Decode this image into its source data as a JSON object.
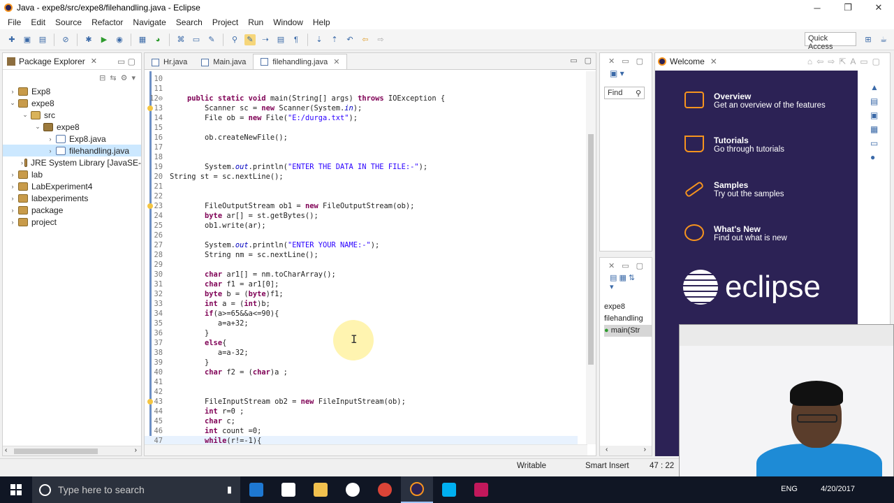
{
  "window": {
    "title": "Java - expe8/src/expe8/filehandling.java - Eclipse",
    "minimize": "─",
    "restore": "❐",
    "close": "✕"
  },
  "menu": [
    "File",
    "Edit",
    "Source",
    "Refactor",
    "Navigate",
    "Search",
    "Project",
    "Run",
    "Window",
    "Help"
  ],
  "toolbar": {
    "quick_access": "Quick Access"
  },
  "package_explorer": {
    "title": "Package Explorer",
    "items": [
      {
        "label": "Exp8",
        "level": 0,
        "arrow": "›",
        "icon": "project-icon"
      },
      {
        "label": "expe8",
        "level": 0,
        "arrow": "⌄",
        "icon": "project-icon"
      },
      {
        "label": "src",
        "level": 1,
        "arrow": "⌄",
        "icon": "source-folder-icon"
      },
      {
        "label": "expe8",
        "level": 2,
        "arrow": "⌄",
        "icon": "package-icon"
      },
      {
        "label": "Exp8.java",
        "level": 3,
        "arrow": "›",
        "icon": "java-file-icon"
      },
      {
        "label": "filehandling.java",
        "level": 3,
        "arrow": "›",
        "icon": "java-file-icon",
        "selected": true
      },
      {
        "label": "JRE System Library [JavaSE-",
        "level": 1,
        "arrow": "›",
        "icon": "library-icon"
      },
      {
        "label": "lab",
        "level": 0,
        "arrow": "›",
        "icon": "project-icon"
      },
      {
        "label": "LabExperiment4",
        "level": 0,
        "arrow": "›",
        "icon": "project-icon"
      },
      {
        "label": "labexperiments",
        "level": 0,
        "arrow": "›",
        "icon": "project-icon"
      },
      {
        "label": "package",
        "level": 0,
        "arrow": "›",
        "icon": "project-icon"
      },
      {
        "label": "project",
        "level": 0,
        "arrow": "›",
        "icon": "project-icon"
      }
    ]
  },
  "editor": {
    "tabs": [
      {
        "label": "Hr.java",
        "active": false
      },
      {
        "label": "Main.java",
        "active": false
      },
      {
        "label": "filehandling.java",
        "active": true
      }
    ],
    "lines": [
      {
        "n": "10",
        "t": ""
      },
      {
        "n": "11",
        "t": ""
      },
      {
        "n": "12⊖",
        "t": "    public static void main(String[] args) throws IOException {"
      },
      {
        "n": "13",
        "t": "        Scanner sc = new Scanner(System.in);",
        "warn": true
      },
      {
        "n": "14",
        "t": "        File ob = new File(\"E:/durga.txt\");"
      },
      {
        "n": "15",
        "t": ""
      },
      {
        "n": "16",
        "t": "        ob.createNewFile();"
      },
      {
        "n": "17",
        "t": ""
      },
      {
        "n": "18",
        "t": ""
      },
      {
        "n": "19",
        "t": "        System.out.println(\"ENTER THE DATA IN THE FILE:-\");"
      },
      {
        "n": "20",
        "t": "String st = sc.nextLine();"
      },
      {
        "n": "21",
        "t": ""
      },
      {
        "n": "22",
        "t": ""
      },
      {
        "n": "23",
        "t": "        FileOutputStream ob1 = new FileOutputStream(ob);",
        "warn": true
      },
      {
        "n": "24",
        "t": "        byte ar[] = st.getBytes();"
      },
      {
        "n": "25",
        "t": "        ob1.write(ar);"
      },
      {
        "n": "26",
        "t": ""
      },
      {
        "n": "27",
        "t": "        System.out.println(\"ENTER YOUR NAME:-\");"
      },
      {
        "n": "28",
        "t": "        String nm = sc.nextLine();"
      },
      {
        "n": "29",
        "t": ""
      },
      {
        "n": "30",
        "t": "        char ar1[] = nm.toCharArray();"
      },
      {
        "n": "31",
        "t": "        char f1 = ar1[0];"
      },
      {
        "n": "32",
        "t": "        byte b = (byte)f1;"
      },
      {
        "n": "33",
        "t": "        int a = (int)b;"
      },
      {
        "n": "34",
        "t": "        if(a>=65&&a<=90){"
      },
      {
        "n": "35",
        "t": "           a=a+32;"
      },
      {
        "n": "36",
        "t": "        }"
      },
      {
        "n": "37",
        "t": "        else{"
      },
      {
        "n": "38",
        "t": "           a=a-32;"
      },
      {
        "n": "39",
        "t": "        }"
      },
      {
        "n": "40",
        "t": "        char f2 = (char)a ;"
      },
      {
        "n": "41",
        "t": ""
      },
      {
        "n": "42",
        "t": ""
      },
      {
        "n": "43",
        "t": "        FileInputStream ob2 = new FileInputStream(ob);",
        "warn": true
      },
      {
        "n": "44",
        "t": "        int r=0 ;"
      },
      {
        "n": "45",
        "t": "        char c;"
      },
      {
        "n": "46",
        "t": "        int count =0;"
      },
      {
        "n": "47",
        "t": "        while(r!=-1){",
        "current": true
      }
    ]
  },
  "find": {
    "placeholder": "Find"
  },
  "outline": {
    "items": [
      "expe8",
      "filehandling",
      "main(Str"
    ]
  },
  "welcome": {
    "tab": "Welcome",
    "items": [
      {
        "title": "Overview",
        "desc": "Get an overview of the features"
      },
      {
        "title": "Tutorials",
        "desc": "Go through tutorials"
      },
      {
        "title": "Samples",
        "desc": "Try out the samples"
      },
      {
        "title": "What's New",
        "desc": "Find out what is new"
      }
    ],
    "logo": "eclipse"
  },
  "status": {
    "writable": "Writable",
    "insert": "Smart Insert",
    "position": "47 : 22"
  },
  "taskbar": {
    "search_placeholder": "Type here to search",
    "lang": "ENG",
    "date": "4/20/2017"
  },
  "colors": {
    "welcome_bg": "#2c2255",
    "accent": "#f7941e",
    "keyword": "#7f0055",
    "string": "#2a00ff"
  }
}
